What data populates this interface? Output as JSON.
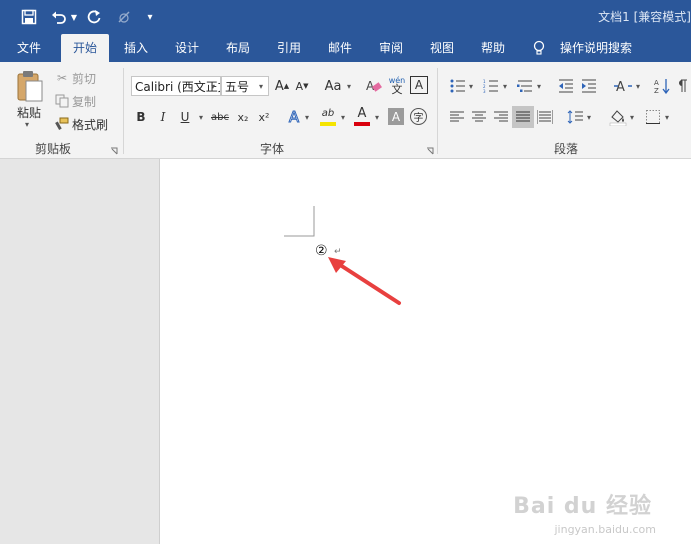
{
  "window": {
    "title": "文档1 [兼容模式]"
  },
  "tabs": [
    {
      "label": "文件"
    },
    {
      "label": "开始"
    },
    {
      "label": "插入"
    },
    {
      "label": "设计"
    },
    {
      "label": "布局"
    },
    {
      "label": "引用"
    },
    {
      "label": "邮件"
    },
    {
      "label": "审阅"
    },
    {
      "label": "视图"
    },
    {
      "label": "帮助"
    }
  ],
  "tell_me": {
    "label": "操作说明搜索"
  },
  "clipboard": {
    "paste_label": "粘贴",
    "cut_label": "剪切",
    "copy_label": "复制",
    "format_painter_label": "格式刷",
    "group_label": "剪贴板"
  },
  "font": {
    "font_name": "Calibri (西文正文)",
    "font_size": "五号",
    "case_label": "Aa",
    "phonetic_label": "wén",
    "bold": "B",
    "italic": "I",
    "underline": "U",
    "strike": "abc",
    "subscript": "x₂",
    "superscript": "x²",
    "text_effect": "A",
    "highlight": "ab",
    "font_color": "A",
    "char_shading": "A",
    "enclose": "字",
    "group_label": "字体",
    "highlight_color": "#f5e400",
    "font_color_value": "#d9000d"
  },
  "paragraph": {
    "group_label": "段落"
  },
  "document": {
    "enclosed_char": "②",
    "para_mark": "↵",
    "arrow_color": "#e8403f"
  },
  "watermark": {
    "brand": "Bai du 经验",
    "url": "jingyan.baidu.com"
  }
}
